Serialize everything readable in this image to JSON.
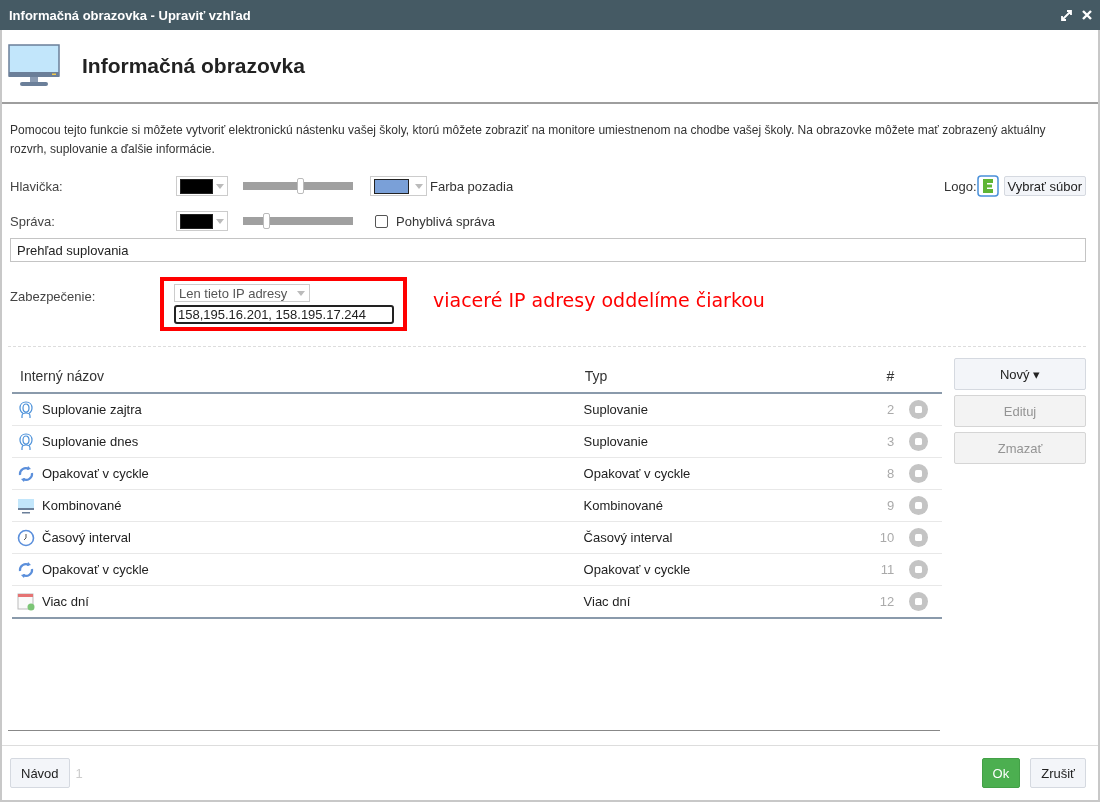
{
  "window": {
    "title": "Informačná obrazovka - Upraviť vzhľad"
  },
  "header": {
    "title": "Informačná obrazovka"
  },
  "description": "Pomocou tejto funkcie si môžete vytvoriť elektronickú nástenku vašej školy, ktorú môžete zobraziť na monitore umiestnenom na chodbe vašej školy. Na obrazovke môžete mať zobrazený aktuálny rozvrh, suplovanie a ďalšie informácie.",
  "header_row": {
    "label": "Hlavička:",
    "color": "#000000",
    "level": 0.53,
    "background": {
      "color": "#7aa0d8",
      "label": "Farba pozadia"
    },
    "logo_label": "Logo:",
    "logo_button": "Vybrať súbor"
  },
  "message_row": {
    "label": "Správa:",
    "color": "#000000",
    "level": 0.22,
    "moving_label": "Pohyblivá správa",
    "moving_checked": false
  },
  "message_text": {
    "value": "Prehľad suplovania"
  },
  "security": {
    "label": "Zabezpečenie:",
    "mode": "Len tieto IP adresy",
    "ip_value": "158,195.16.201, 158.195.17.244",
    "annotation": "viaceré IP adresy oddelíme čiarkou"
  },
  "table": {
    "columns": [
      "Interný názov",
      "Typ",
      "#"
    ],
    "rows": [
      {
        "kind": "person",
        "name": "Suplovanie zajtra",
        "type": "Suplovanie",
        "number": "2"
      },
      {
        "kind": "person",
        "name": "Suplovanie dnes",
        "type": "Suplovanie",
        "number": "3"
      },
      {
        "kind": "cycle",
        "name": "Opakovať v cyckle",
        "type": "Opakovať v cyckle",
        "number": "8"
      },
      {
        "kind": "monitor",
        "name": "Kombinované",
        "type": "Kombinované",
        "number": "9"
      },
      {
        "kind": "clock",
        "name": "Časový interval",
        "type": "Časový interval",
        "number": "10"
      },
      {
        "kind": "cycle",
        "name": "Opakovať v cyckle",
        "type": "Opakovať v cyckle",
        "number": "11"
      },
      {
        "kind": "calendar",
        "name": "Viac dní",
        "type": "Viac dní",
        "number": "12"
      }
    ]
  },
  "side_buttons": [
    {
      "label": "Nový ▾",
      "disabled": false
    },
    {
      "label": "Edituj",
      "disabled": true
    },
    {
      "label": "Zmazať",
      "disabled": true
    }
  ],
  "footer": {
    "help_button": "Návod",
    "help_count": "1",
    "ok_button": "Ok",
    "cancel_button": "Zrušiť"
  }
}
